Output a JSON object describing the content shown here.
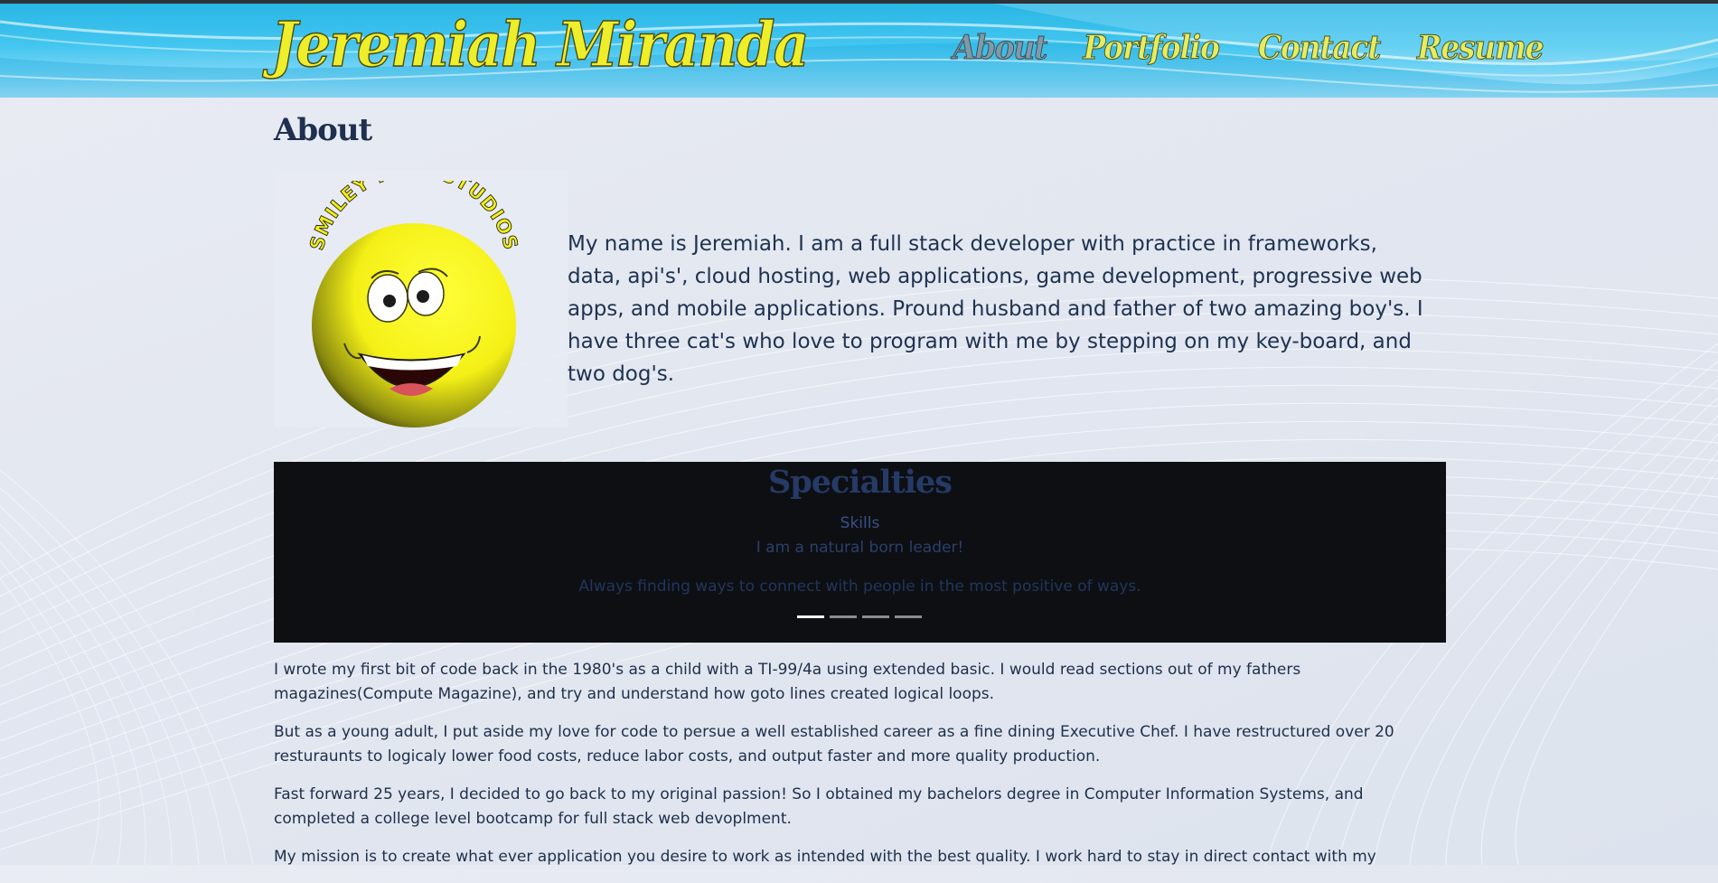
{
  "header": {
    "site_title": "Jeremiah Miranda",
    "nav": [
      "About",
      "Portfolio",
      "Contact",
      "Resume"
    ],
    "active_nav": "About"
  },
  "main": {
    "page_title": "About",
    "logo_text": "SMILEY FACE STUDIOS",
    "intro": "My name is Jeremiah. I am a full stack developer with practice in frameworks, data, api's', cloud hosting, web applications, game development, progressive web apps, and mobile applications. Pround husband and father of two amazing boy's. I have three cat's who love to program with me by stepping on my key-board, and two dog's."
  },
  "carousel": {
    "title": "Specialties",
    "subtitle": "Skills",
    "line1": "I am a natural born leader!",
    "line2": "Always finding ways to connect with people in the most positive of ways.",
    "slide_count": 4,
    "active_slide": 1
  },
  "body": {
    "paragraphs": [
      "I wrote my first bit of code back in the 1980's as a child with a TI-99/4a using extended basic. I would read sections out of my fathers magazines(Compute Magazine), and try and understand how goto lines created logical loops.",
      "But as a young adult, I put aside my love for code to persue a well established career as a fine dining Executive Chef. I have restructured over 20 resturaunts to logicaly lower food costs, reduce labor costs, and output faster and more quality production.",
      "Fast forward 25 years, I decided to go back to my original passion! So I obtained my bachelors degree in Computer Information Systems, and completed a college level bootcamp for full stack web devoplment.",
      "My mission is to create what ever application you desire to work as intended with the best quality. I work hard to stay in direct contact with my"
    ]
  },
  "colors": {
    "header_blue": "#29b6e6",
    "title_yellow": "#eeee2a",
    "nav_yellow": "#e6ec62",
    "nav_active": "#7f9aa8",
    "heading_navy": "#1f2f4f",
    "carousel_bg": "#0d0f13"
  }
}
